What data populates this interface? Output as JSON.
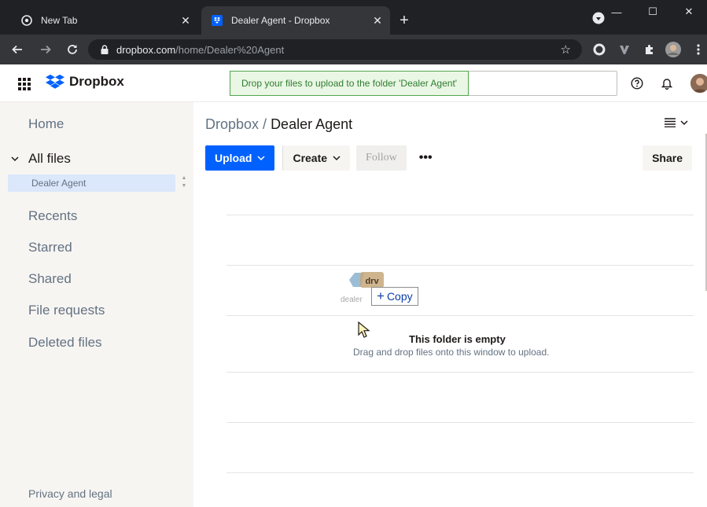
{
  "browser": {
    "tabs": [
      {
        "title": "New Tab",
        "icon": "new-tab-icon",
        "active": false
      },
      {
        "title": "Dealer Agent - Dropbox",
        "icon": "dropbox-icon",
        "active": true
      }
    ],
    "close_glyph": "✕",
    "new_tab_glyph": "+",
    "window_controls": [
      "—",
      "☐",
      "✕"
    ],
    "url_host": "dropbox.com",
    "url_path": "/home/Dealer%20Agent"
  },
  "header": {
    "logo_text": "Dropbox",
    "drop_hint": "Drop your files to upload to the folder 'Dealer Agent'",
    "help_icon": "help-icon",
    "bell_icon": "bell-icon"
  },
  "sidebar": {
    "home": "Home",
    "all_files": "All files",
    "current_folder": "Dealer Agent",
    "items": [
      "Recents",
      "Starred",
      "Shared",
      "File requests",
      "Deleted files"
    ],
    "privacy": "Privacy and legal"
  },
  "main": {
    "breadcrumb_root": "Dropbox",
    "breadcrumb_sep": " / ",
    "breadcrumb_current": "Dealer Agent",
    "buttons": {
      "upload": "Upload",
      "create": "Create",
      "follow": "Follow",
      "more": "•••",
      "share": "Share"
    },
    "empty_title": "This folder is empty",
    "empty_subtitle": "Drag and drop files onto this window to upload."
  },
  "drag": {
    "file_label": "dealer",
    "copy_label": "Copy",
    "plus": "+"
  },
  "colors": {
    "chrome_dark": "#202124",
    "chrome_toolbar": "#35363a",
    "dropbox_blue": "#0061fe",
    "sidebar_bg": "#f7f5f2",
    "drop_hint_green": "#52a550"
  }
}
